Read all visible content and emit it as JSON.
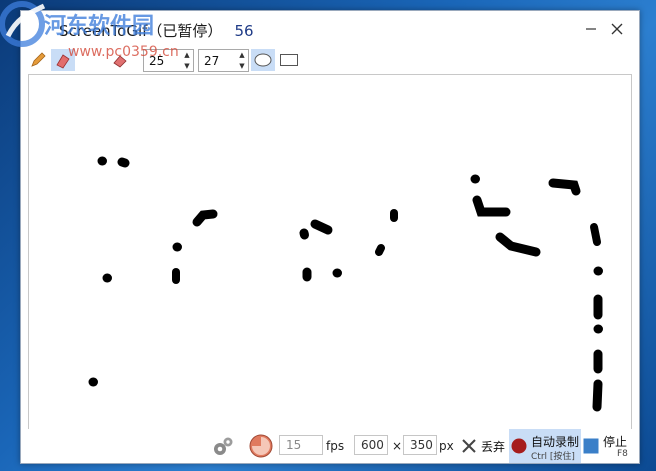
{
  "window": {
    "title": "ScreenToGif（已暂停）",
    "frame_count": "56"
  },
  "watermark": {
    "text": "河东软件园",
    "url": "www.pc0359.cn"
  },
  "toolbar": {
    "thickness_value": "25",
    "height_value": "27"
  },
  "status": {
    "fps_value": "15",
    "fps_unit": "fps",
    "width_value": "600",
    "times_sign": "×",
    "height_value": "350",
    "px_unit": "px",
    "discard_label": "丢弃",
    "record_label": "自动录制",
    "record_shortcut": "Ctrl [按住]",
    "stop_label": "停止",
    "stop_shortcut": "F8"
  },
  "colors": {
    "record_red": "#a61d1d",
    "stop_blue": "#3a7fc8",
    "selected_bg": "#c9ddf6",
    "watermark_blue": "#3d7ddc"
  }
}
